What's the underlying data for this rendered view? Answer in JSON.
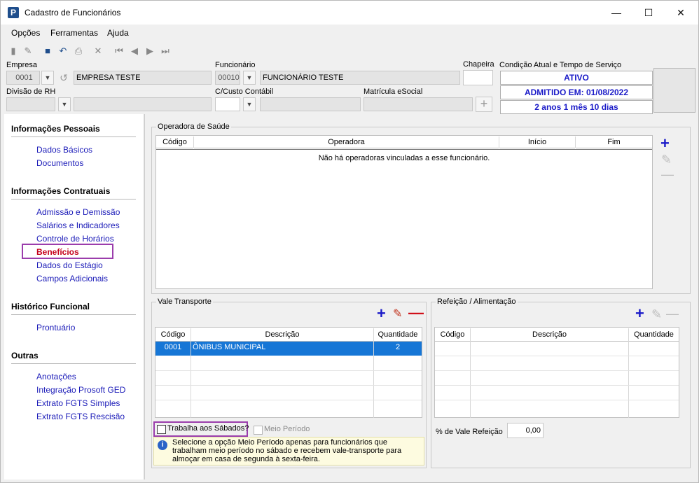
{
  "window": {
    "title": "Cadastro de Funcionários",
    "icon_letter": "P"
  },
  "menu": [
    "Opções",
    "Ferramentas",
    "Ajuda"
  ],
  "header": {
    "empresa_label": "Empresa",
    "empresa_code": "0001",
    "empresa_name": "EMPRESA TESTE",
    "funcionario_label": "Funcionário",
    "funcionario_code": "00010",
    "funcionario_name": "FUNCIONÁRIO TESTE",
    "chapeira_label": "Chapeira",
    "chapeira_value": "",
    "condicao_label": "Condição Atual e Tempo de Serviço",
    "status_ativo": "ATIVO",
    "status_admitido": "ADMITIDO EM: 01/08/2022",
    "status_tempo": "2 anos 1 mês 10 dias",
    "divisao_label": "Divisão de RH",
    "custo_label": "C/Custo Contábil",
    "matricula_label": "Matrícula eSocial"
  },
  "sidebar": {
    "sections": [
      {
        "title": "Informações Pessoais",
        "items": [
          "Dados Básicos",
          "Documentos"
        ]
      },
      {
        "title": "Informações Contratuais",
        "items": [
          "Admissão e Demissão",
          "Salários e Indicadores",
          "Controle de Horários",
          "Benefícios",
          "Dados do Estágio",
          "Campos Adicionais"
        ]
      },
      {
        "title": "Histórico Funcional",
        "items": [
          "Prontuário"
        ]
      },
      {
        "title": "Outras",
        "items": [
          "Anotações",
          "Integração Prosoft GED",
          "Extrato FGTS Simples",
          "Extrato FGTS Rescisão"
        ]
      }
    ],
    "active": "Benefícios"
  },
  "operadora": {
    "legend": "Operadora de Saúde",
    "columns": [
      "Código",
      "Operadora",
      "Início",
      "Fim"
    ],
    "empty_message": "Não há operadoras vinculadas a esse funcionário."
  },
  "vale": {
    "legend": "Vale Transporte",
    "columns": [
      "Código",
      "Descrição",
      "Quantidade"
    ],
    "rows": [
      {
        "codigo": "0001",
        "descricao": "ÔNIBUS MUNICIPAL",
        "quantidade": "2"
      }
    ],
    "sabados_label": "Trabalha aos Sábados?",
    "meio_periodo_label": "Meio Período",
    "info": "Selecione a opção Meio Período apenas para funcionários que trabalham meio período no sábado e recebem vale-transporte para almoçar em casa de segunda à sexta-feira."
  },
  "refeicao": {
    "legend": "Refeição / Alimentação",
    "columns": [
      "Código",
      "Descrição",
      "Quantidade"
    ],
    "percent_label": "% de Vale Refeição",
    "percent_value": "0,00"
  },
  "colors": {
    "accent": "#1a1ac8",
    "active_link": "#c4001b",
    "highlight": "#9b3dac",
    "selection": "#1676d6"
  }
}
